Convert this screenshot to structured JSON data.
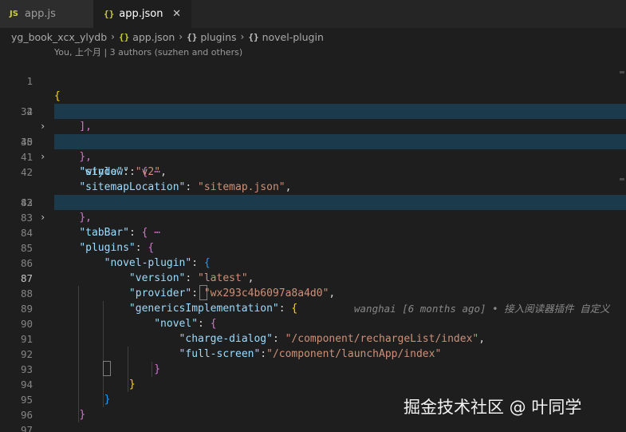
{
  "tabs": [
    {
      "icon": "JS",
      "label": "app.js",
      "active": false
    },
    {
      "icon": "{}",
      "label": "app.json",
      "active": true,
      "close": "✕"
    }
  ],
  "breadcrumb": {
    "folder": "yg_book_xcx_ylydb",
    "file_icon": "{}",
    "file": "app.json",
    "obj_icon": "{}",
    "segment1": "plugins",
    "segment2": "novel-plugin",
    "sep": "›"
  },
  "codelens": "You, 上个月 | 3 authors (suzhen and others)",
  "blame": "wanghai [6 months ago] • 接入阅读器插件 自定义",
  "watermark": "掘金技术社区 @ 叶同学",
  "lines": [
    {
      "num": "1",
      "text": "{"
    },
    {
      "num": "2",
      "key": "\"pages\"",
      "rest": "[ ⋯"
    },
    {
      "num": "34",
      "text": "],"
    },
    {
      "num": "35",
      "key": "\"window\"",
      "rest": "{ ⋯"
    },
    {
      "num": "40",
      "text": "},"
    },
    {
      "num": "41",
      "key": "\"style\"",
      "value": "\"v2\""
    },
    {
      "num": "42",
      "key": "\"sitemapLocation\"",
      "value": "\"sitemap.json\""
    },
    {
      "num": "43",
      "key": "\"tabBar\"",
      "rest": "{ ⋯"
    },
    {
      "num": "82",
      "text": "},"
    },
    {
      "num": "83",
      "text": ""
    },
    {
      "num": "84",
      "key": "\"plugins\"",
      "rest": "{"
    },
    {
      "num": "85",
      "key": "\"novel-plugin\"",
      "rest": "{"
    },
    {
      "num": "86",
      "key": "\"version\"",
      "value": "\"latest\""
    },
    {
      "num": "87",
      "key": "\"provider\"",
      "value": "\"wx293c4b6097a8a4d0\""
    },
    {
      "num": "88",
      "key": "\"genericsImplementation\"",
      "rest": "{"
    },
    {
      "num": "89",
      "key": "\"novel\"",
      "rest": "{"
    },
    {
      "num": "90",
      "key": "\"charge-dialog\"",
      "value": "\"/component/rechargeList/index\""
    },
    {
      "num": "91",
      "key": "\"full-screen\"",
      "value": "\"/component/launchApp/index\""
    },
    {
      "num": "92",
      "text": "}"
    },
    {
      "num": "93",
      "text": "}"
    },
    {
      "num": "94",
      "text": "}"
    },
    {
      "num": "95",
      "text": "}"
    },
    {
      "num": "96",
      "text": ""
    },
    {
      "num": "97",
      "text": "}"
    }
  ]
}
